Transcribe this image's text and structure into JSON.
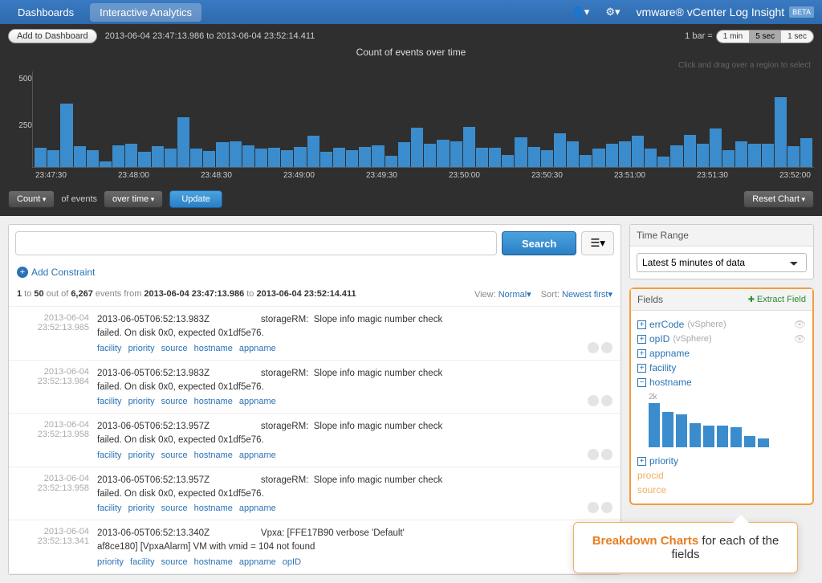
{
  "topbar": {
    "tabs": [
      "Dashboards",
      "Interactive Analytics"
    ],
    "active_tab": 1,
    "brand": "vmware® vCenter Log Insight",
    "badge": "BETA"
  },
  "chart_header": {
    "add_dash": "Add to Dashboard",
    "range_text": "2013-06-04 23:47:13.986 to 2013-06-04 23:52:14.411",
    "bar_label": "1 bar =",
    "bar_options": [
      "1 min",
      "5 sec",
      "1 sec"
    ],
    "bar_selected": 1
  },
  "chart_data": {
    "type": "bar",
    "title": "Count of events over time",
    "hint": "Click and drag over a region to select",
    "ylabel_ticks": [
      "500",
      "250",
      ""
    ],
    "ylim": [
      0,
      500
    ],
    "x_ticks": [
      "23:47:30",
      "23:48:00",
      "23:48:30",
      "23:49:00",
      "23:49:30",
      "23:50:00",
      "23:50:30",
      "23:51:00",
      "23:51:30",
      "23:52:00"
    ],
    "values": [
      100,
      90,
      330,
      110,
      90,
      30,
      115,
      120,
      80,
      110,
      95,
      260,
      95,
      85,
      130,
      135,
      115,
      95,
      100,
      90,
      105,
      165,
      80,
      100,
      90,
      105,
      115,
      60,
      130,
      205,
      120,
      145,
      135,
      210,
      100,
      100,
      65,
      155,
      105,
      90,
      175,
      135,
      65,
      95,
      120,
      135,
      165,
      95,
      55,
      115,
      170,
      120,
      200,
      90,
      135,
      120,
      120,
      365,
      110,
      150
    ]
  },
  "chart_controls": {
    "agg": "Count",
    "of": "of events",
    "over": "over time",
    "update": "Update",
    "reset": "Reset Chart"
  },
  "search": {
    "placeholder": "",
    "button": "Search",
    "add_constraint": "Add Constraint"
  },
  "results_meta": {
    "from": "1",
    "to": "50",
    "total": "6,267",
    "range_from": "2013-06-04 23:47:13.986",
    "range_to": "2013-06-04 23:52:14.411",
    "view_label": "View:",
    "view_value": "Normal",
    "sort_label": "Sort:",
    "sort_value": "Newest first"
  },
  "events": [
    {
      "date": "2013-06-04",
      "time": "23:52:13.985",
      "msg": "2013-06-05T06:52:13.983Z                    storageRM:  Slope info magic number check\nfailed. On disk 0x0, expected 0x1df5e76.",
      "tags": [
        "facility",
        "priority",
        "source",
        "hostname",
        "appname"
      ]
    },
    {
      "date": "2013-06-04",
      "time": "23:52:13.984",
      "msg": "2013-06-05T06:52:13.983Z                    storageRM:  Slope info magic number check\nfailed. On disk 0x0, expected 0x1df5e76.",
      "tags": [
        "facility",
        "priority",
        "source",
        "hostname",
        "appname"
      ]
    },
    {
      "date": "2013-06-04",
      "time": "23:52:13.958",
      "msg": "2013-06-05T06:52:13.957Z                    storageRM:  Slope info magic number check\nfailed. On disk 0x0, expected 0x1df5e76.",
      "tags": [
        "facility",
        "priority",
        "source",
        "hostname",
        "appname"
      ]
    },
    {
      "date": "2013-06-04",
      "time": "23:52:13.958",
      "msg": "2013-06-05T06:52:13.957Z                    storageRM:  Slope info magic number check\nfailed. On disk 0x0, expected 0x1df5e76.",
      "tags": [
        "facility",
        "priority",
        "source",
        "hostname",
        "appname"
      ]
    },
    {
      "date": "2013-06-04",
      "time": "23:52:13.341",
      "msg": "2013-06-05T06:52:13.340Z                    Vpxa: [FFE17B90 verbose 'Default'\naf8ce180] [VpxaAlarm] VM with vmid = 104 not found",
      "tags": [
        "priority",
        "facility",
        "source",
        "hostname",
        "appname",
        "opID"
      ]
    }
  ],
  "time_panel": {
    "title": "Time Range",
    "value": "Latest 5 minutes of data"
  },
  "fields_panel": {
    "title": "Fields",
    "extract": "Extract Field",
    "items": [
      {
        "sym": "+",
        "name": "errCode",
        "src": "(vSphere)",
        "eye": true
      },
      {
        "sym": "+",
        "name": "opID",
        "src": "(vSphere)",
        "eye": true
      },
      {
        "sym": "+",
        "name": "appname"
      },
      {
        "sym": "+",
        "name": "facility"
      },
      {
        "sym": "−",
        "name": "hostname"
      }
    ],
    "mini_label": "2k",
    "mini_values": [
      100,
      80,
      75,
      55,
      50,
      50,
      45,
      25,
      20
    ],
    "tail": [
      {
        "sym": "+",
        "name": "priority"
      },
      {
        "name": "procid",
        "faded": true
      },
      {
        "name": "source",
        "faded": true
      }
    ]
  },
  "callout": {
    "bold": "Breakdown Charts",
    "rest": " for each of the fields"
  }
}
